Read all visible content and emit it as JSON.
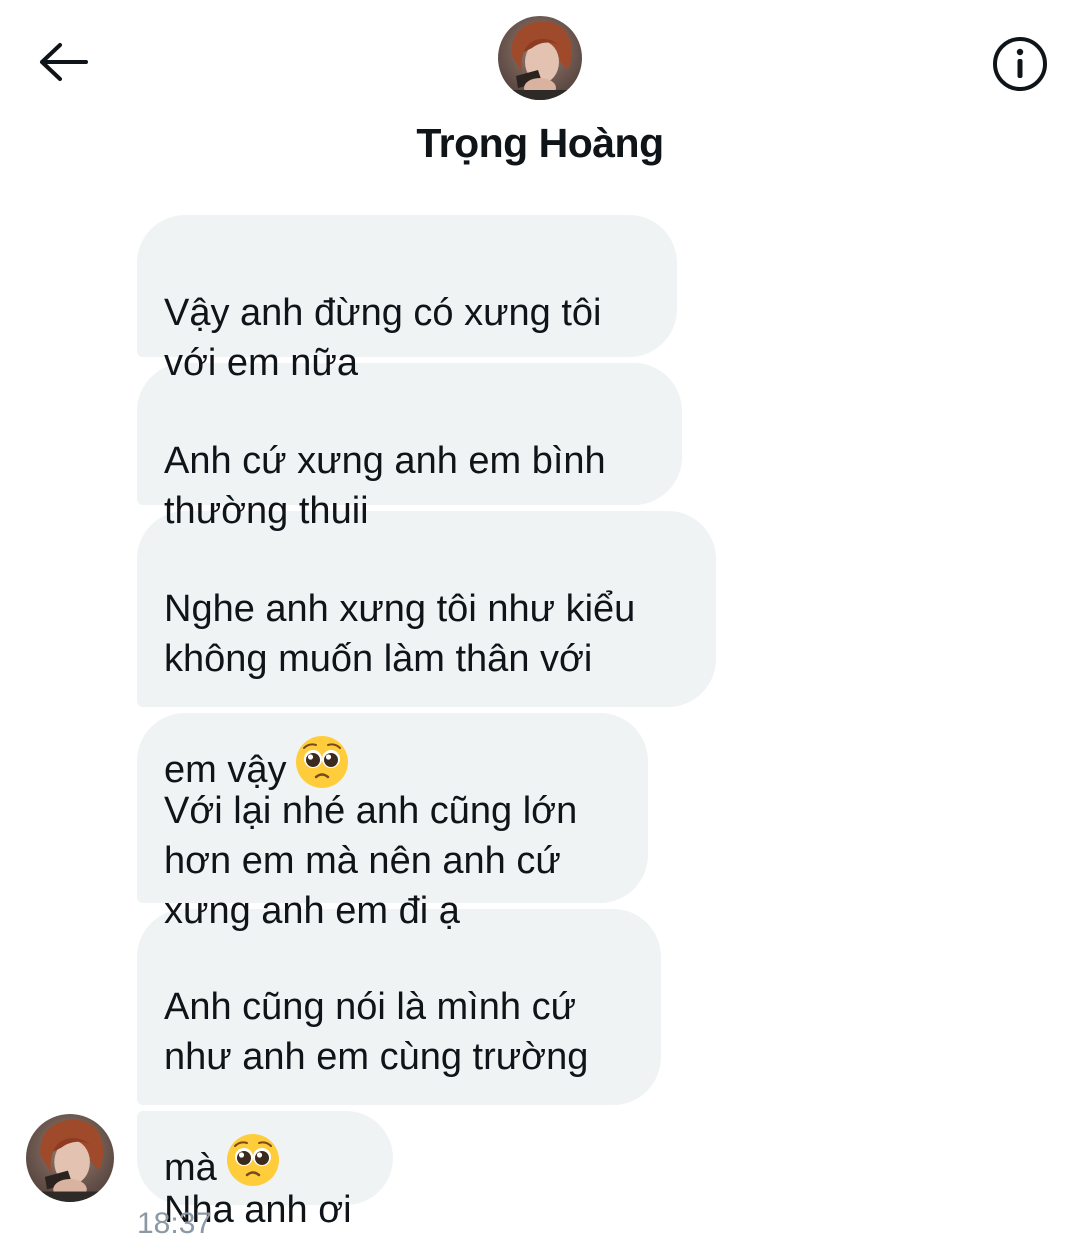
{
  "header": {
    "contact_name": "Trọng Hoàng",
    "back_icon": "arrow-left-icon",
    "info_icon": "info-circle-icon"
  },
  "messages": [
    {
      "text": "Vậy anh đừng có xưng tôi\nvới em nữa",
      "emoji": ""
    },
    {
      "text": "Anh cứ xưng anh em bình\nthường thuii",
      "emoji": ""
    },
    {
      "text": "Nghe anh xưng tôi như kiểu\nkhông muốn làm thân với\nem vậy",
      "emoji": "pleading-face"
    },
    {
      "text": "Với lại nhé anh cũng lớn\nhơn em mà nên anh cứ\nxưng anh em đi ạ",
      "emoji": ""
    },
    {
      "text": "Anh cũng nói là mình cứ\nnhư anh em cùng trường\nmà",
      "emoji": "pleading-face"
    },
    {
      "text": "Nha anh ơi",
      "emoji": ""
    }
  ],
  "timestamp": "18:37",
  "colors": {
    "bubble_bg": "#eff3f4",
    "text": "#0f1419",
    "timestamp": "#8b98a5"
  }
}
